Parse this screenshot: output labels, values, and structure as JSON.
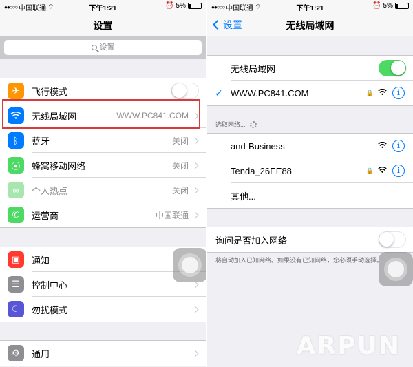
{
  "status_bar": {
    "carrier": "中国联通",
    "time": "下午1:21",
    "battery": "5%"
  },
  "left": {
    "title": "设置",
    "search_placeholder": "设置",
    "group1": [
      {
        "label": "飞行模式",
        "icon": "airplane-icon",
        "color": "#ff9500",
        "toggle": "off"
      },
      {
        "label": "无线局域网",
        "value": "WWW.PC841.COM",
        "icon": "wifi-icon",
        "color": "#007aff"
      },
      {
        "label": "蓝牙",
        "value": "关闭",
        "icon": "bluetooth-icon",
        "color": "#007aff"
      },
      {
        "label": "蜂窝移动网络",
        "value": "关闭",
        "icon": "cellular-icon",
        "color": "#4cd964"
      },
      {
        "label": "个人热点",
        "value": "关闭",
        "icon": "hotspot-icon",
        "color": "#4cd964",
        "dimmed": true
      },
      {
        "label": "运营商",
        "value": "中国联通",
        "icon": "phone-icon",
        "color": "#4cd964"
      }
    ],
    "group2": [
      {
        "label": "通知",
        "icon": "notifications-icon",
        "color": "#ff3b30"
      },
      {
        "label": "控制中心",
        "icon": "control-center-icon",
        "color": "#8e8e93"
      },
      {
        "label": "勿扰模式",
        "icon": "moon-icon",
        "color": "#5856d6"
      }
    ],
    "group3": [
      {
        "label": "通用",
        "icon": "gear-icon",
        "color": "#8e8e93"
      }
    ]
  },
  "right": {
    "back_label": "设置",
    "title": "无线局域网",
    "wifi_label": "无线局域网",
    "wifi_toggle": "on",
    "connected_network": "WWW.PC841.COM",
    "choose_network_header": "选取网络...",
    "networks": [
      {
        "name": "and-Business",
        "locked": false
      },
      {
        "name": "Tenda_26EE88",
        "locked": true
      },
      {
        "name": "其他..."
      }
    ],
    "ask_join_label": "询问是否加入网络",
    "ask_join_toggle": "off",
    "ask_join_note": "将自动加入已知网络。如果没有已知网络，您必须手动选择。"
  },
  "watermark": "ARPUN"
}
